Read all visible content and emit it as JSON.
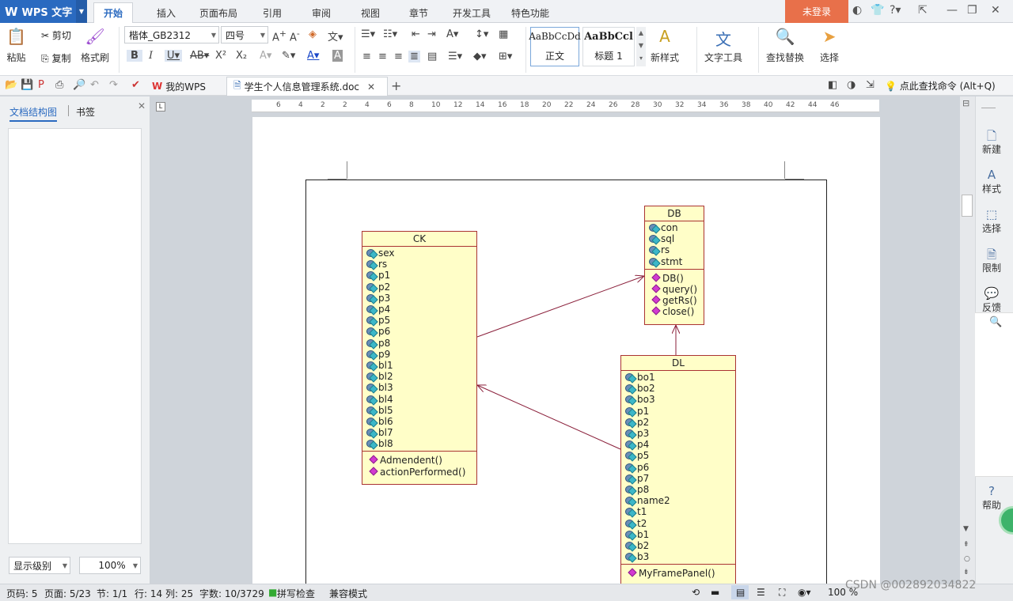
{
  "app": {
    "title": "WPS 文字"
  },
  "tabs": [
    "开始",
    "插入",
    "页面布局",
    "引用",
    "审阅",
    "视图",
    "章节",
    "开发工具",
    "特色功能"
  ],
  "login_label": "未登录",
  "ribbon": {
    "paste": "粘贴",
    "cut": "剪切",
    "copy": "复制",
    "format_painter": "格式刷",
    "font_name": "楷体_GB2312",
    "font_size": "四号",
    "style_normal_preview": "AaBbCcDd",
    "style_normal": "正文",
    "style_h1_preview": "AaBbCcl",
    "style_h1": "标题 1",
    "new_style": "新样式",
    "text_tools": "文字工具",
    "find_replace": "查找替换",
    "select": "选择"
  },
  "quickbar": {
    "my_wps": "我的WPS",
    "doc_tab": "学生个人信息管理系统.doc",
    "search_cmd": "点此查找命令 (Alt+Q)"
  },
  "leftpanel": {
    "tab_outline": "文档结构图",
    "tab_bookmark": "书签",
    "level_select": "显示级别",
    "zoom_select": "100%"
  },
  "ruler": {
    "ticks": [
      "6",
      "4",
      "2",
      "2",
      "4",
      "6",
      "8",
      "10",
      "12",
      "14",
      "16",
      "18",
      "20",
      "22",
      "24",
      "26",
      "28",
      "30",
      "32",
      "34",
      "36",
      "38",
      "40",
      "42",
      "44",
      "46"
    ]
  },
  "diagram": {
    "ck": {
      "name": "CK",
      "attributes": [
        "sex",
        "rs",
        "p1",
        "p2",
        "p3",
        "p4",
        "p5",
        "p6",
        "p8",
        "p9",
        "bl1",
        "bl2",
        "bl3",
        "bl4",
        "bl5",
        "bl6",
        "bl7",
        "bl8"
      ],
      "operations": [
        "Admendent()",
        "actionPerformed()"
      ]
    },
    "db": {
      "name": "DB",
      "attributes": [
        "con",
        "sql",
        "rs",
        "stmt"
      ],
      "operations": [
        "DB()",
        "query()",
        "getRs()",
        "close()"
      ]
    },
    "dl": {
      "name": "DL",
      "attributes": [
        "bo1",
        "bo2",
        "bo3",
        "p1",
        "p2",
        "p3",
        "p4",
        "p5",
        "p6",
        "p7",
        "p8",
        "name2",
        "t1",
        "t2",
        "b1",
        "b2",
        "b3"
      ],
      "operations": [
        "MyFramePanel()"
      ]
    }
  },
  "rightbar": [
    "新建",
    "样式",
    "选择",
    "限制",
    "反馈",
    "帮助"
  ],
  "status": {
    "page": "页码: 5",
    "pages": "页面: 5/23",
    "section": "节: 1/1",
    "row": "行: 14",
    "col": "列: 25",
    "words": "字数: 10/3729",
    "spell": "拼写检查",
    "compat": "兼容模式",
    "zoom": "100 %"
  },
  "watermark": "CSDN @002892034822"
}
